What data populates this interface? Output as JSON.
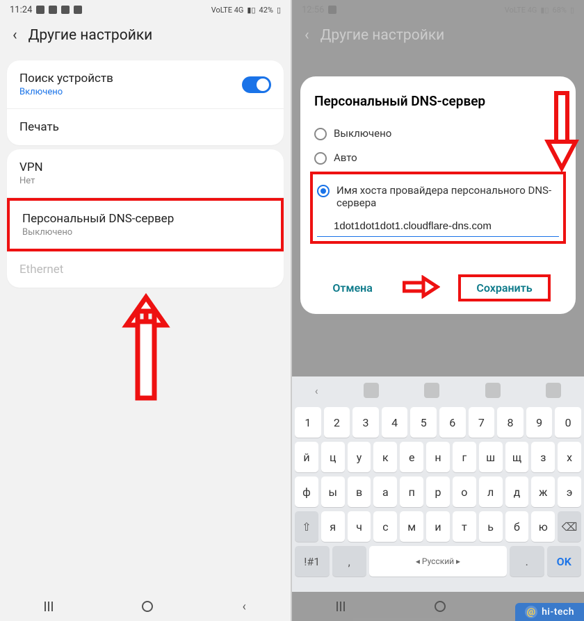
{
  "left": {
    "status": {
      "time": "11:24",
      "net": "VoLTE 4G",
      "battery": "42%"
    },
    "header": "Другие настройки",
    "card1": {
      "device_search": {
        "title": "Поиск устройств",
        "sub": "Включено"
      },
      "print": {
        "title": "Печать"
      }
    },
    "card2": {
      "vpn": {
        "title": "VPN",
        "sub": "Нет"
      },
      "dns": {
        "title": "Персональный DNS-сервер",
        "sub": "Выключено"
      },
      "ethernet": {
        "title": "Ethernet"
      }
    }
  },
  "right": {
    "status": {
      "time": "12:56",
      "net": "VoLTE 4G",
      "battery": "68%"
    },
    "header": "Другие настройки",
    "dialog": {
      "title": "Персональный DNS-сервер",
      "opt_off": "Выключено",
      "opt_auto": "Авто",
      "opt_host": "Имя хоста провайдера персонального DNS-сервера",
      "host_value": "1dot1dot1dot1.cloudflare-dns.com",
      "cancel": "Отмена",
      "save": "Сохранить"
    },
    "keyboard": {
      "row1": [
        "1",
        "2",
        "3",
        "4",
        "5",
        "6",
        "7",
        "8",
        "9",
        "0"
      ],
      "row2": [
        "й",
        "ц",
        "у",
        "к",
        "е",
        "н",
        "г",
        "ш",
        "щ",
        "з",
        "х"
      ],
      "row3": [
        "ф",
        "ы",
        "в",
        "а",
        "п",
        "р",
        "о",
        "л",
        "д",
        "ж",
        "э"
      ],
      "row4_shift": "⇧",
      "row4": [
        "я",
        "ч",
        "с",
        "м",
        "и",
        "т",
        "ь",
        "б",
        "ю"
      ],
      "row4_bksp": "⌫",
      "row5_sym": "!#1",
      "row5_comma": ",",
      "row5_lang": "Русский",
      "row5_dot": ".",
      "row5_ok": "OK"
    }
  },
  "watermark": "hi-tech"
}
